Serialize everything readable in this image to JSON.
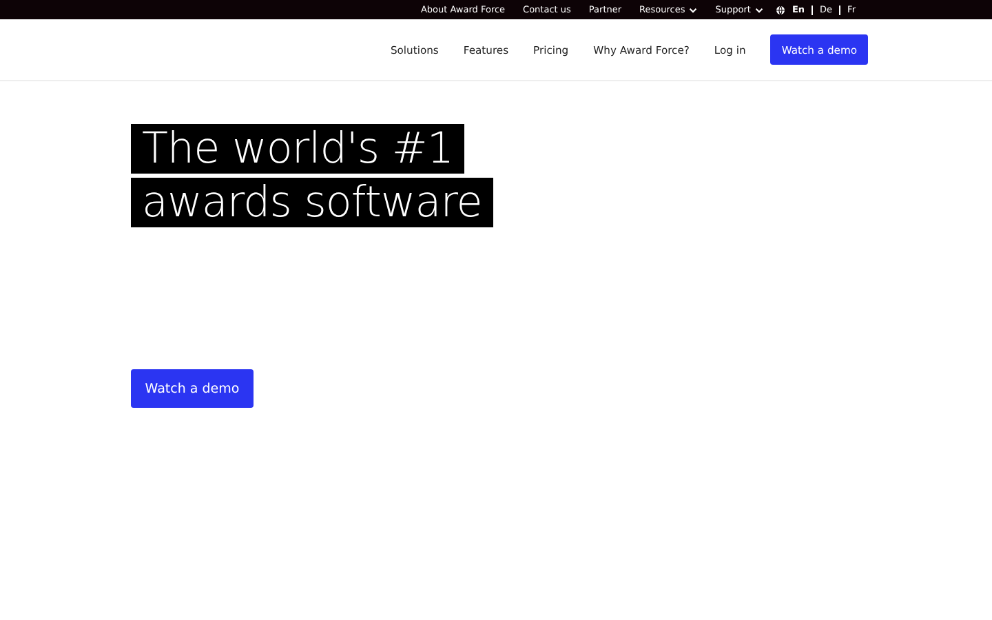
{
  "top_bar": {
    "links": [
      {
        "label": "About Award Force",
        "kind": "link"
      },
      {
        "label": "Contact us",
        "kind": "link"
      },
      {
        "label": "Partner",
        "kind": "link"
      },
      {
        "label": "Resources",
        "kind": "dropdown"
      },
      {
        "label": "Support",
        "kind": "dropdown"
      }
    ],
    "languages": [
      {
        "label": "En",
        "selected": true
      },
      {
        "label": "De",
        "selected": false
      },
      {
        "label": "Fr",
        "selected": false
      }
    ]
  },
  "nav": {
    "items": [
      "Solutions",
      "Features",
      "Pricing",
      "Why Award Force?",
      "Log in"
    ],
    "cta": "Watch a demo"
  },
  "hero": {
    "headline_lines": [
      "The world's #1",
      "awards software"
    ],
    "cta": "Watch a demo"
  }
}
